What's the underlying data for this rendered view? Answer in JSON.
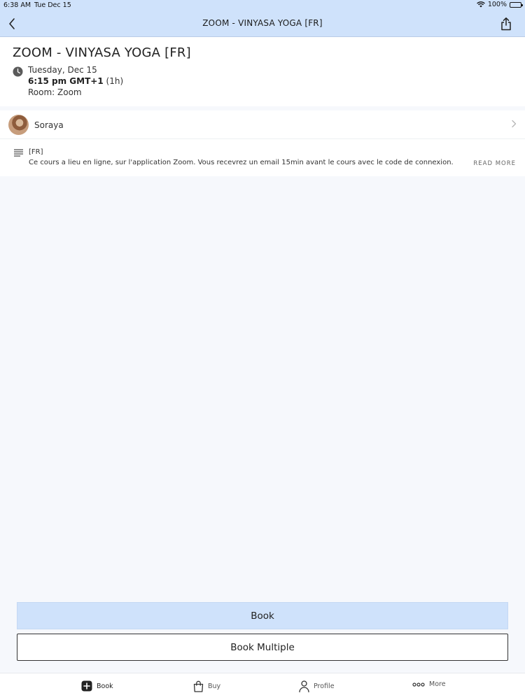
{
  "status_bar": {
    "time": "6:38 AM",
    "date": "Tue Dec 15",
    "battery": "100%"
  },
  "nav": {
    "title": "ZOOM - VINYASA YOGA [FR]",
    "back_icon": "chevron-left-icon",
    "share_icon": "share-icon"
  },
  "class": {
    "title": "ZOOM - VINYASA YOGA [FR]",
    "date": "Tuesday, Dec 15",
    "time": "6:15 pm GMT+1",
    "duration": "(1h)",
    "room": "Room: Zoom"
  },
  "teacher": {
    "name": "Soraya"
  },
  "description": {
    "tag": "[FR]",
    "text": "Ce cours a lieu en ligne, sur l'application Zoom. Vous recevrez un email 15min avant le cours avec le code de connexion.",
    "read_more": "READ MORE"
  },
  "actions": {
    "book": "Book",
    "book_multiple": "Book Multiple"
  },
  "tabs": [
    {
      "label": "Book",
      "icon": "plus-square-icon",
      "active": true
    },
    {
      "label": "Buy",
      "icon": "bag-icon",
      "active": false
    },
    {
      "label": "Profile",
      "icon": "person-icon",
      "active": false
    },
    {
      "label": "More",
      "icon": "more-dots-icon",
      "active": false
    }
  ],
  "colors": {
    "header_bg": "#cfe2fb",
    "page_bg": "#f6f8fc",
    "book_button": "#cfe2fb"
  }
}
